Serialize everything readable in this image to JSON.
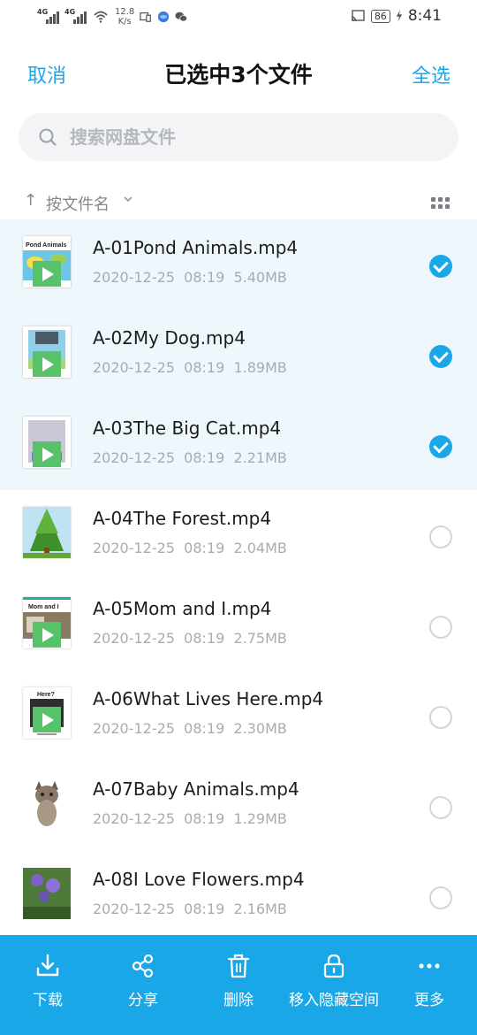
{
  "status_bar": {
    "network1": "4G",
    "network2": "4G",
    "speed_value": "12.8",
    "speed_unit": "K/s",
    "battery": "86",
    "time": "8:41"
  },
  "header": {
    "cancel_label": "取消",
    "title": "已选中3个文件",
    "select_all_label": "全选"
  },
  "search": {
    "placeholder": "搜索网盘文件"
  },
  "sort": {
    "label": "按文件名"
  },
  "files": [
    {
      "name": "A-01Pond Animals.mp4",
      "date": "2020-12-25",
      "time": "08:19",
      "size": "5.40MB",
      "selected": true
    },
    {
      "name": "A-02My Dog.mp4",
      "date": "2020-12-25",
      "time": "08:19",
      "size": "1.89MB",
      "selected": true
    },
    {
      "name": "A-03The Big Cat.mp4",
      "date": "2020-12-25",
      "time": "08:19",
      "size": "2.21MB",
      "selected": true
    },
    {
      "name": "A-04The Forest.mp4",
      "date": "2020-12-25",
      "time": "08:19",
      "size": "2.04MB",
      "selected": false
    },
    {
      "name": "A-05Mom and I.mp4",
      "date": "2020-12-25",
      "time": "08:19",
      "size": "2.75MB",
      "selected": false
    },
    {
      "name": "A-06What Lives Here.mp4",
      "date": "2020-12-25",
      "time": "08:19",
      "size": "2.30MB",
      "selected": false
    },
    {
      "name": "A-07Baby Animals.mp4",
      "date": "2020-12-25",
      "time": "08:19",
      "size": "1.29MB",
      "selected": false
    },
    {
      "name": "A-08I Love Flowers.mp4",
      "date": "2020-12-25",
      "time": "08:19",
      "size": "2.16MB",
      "selected": false
    }
  ],
  "thumb_texts": {
    "t1": "Pond Animals",
    "t5": "Mom and I",
    "t6": "Here?"
  },
  "toolbar": {
    "download": "下载",
    "share": "分享",
    "delete": "删除",
    "move_hidden": "移入隐藏空间",
    "more": "更多"
  },
  "colors": {
    "accent": "#1aa7e8",
    "selected_row_bg": "#eef7fc",
    "play_badge": "#58c26a"
  }
}
